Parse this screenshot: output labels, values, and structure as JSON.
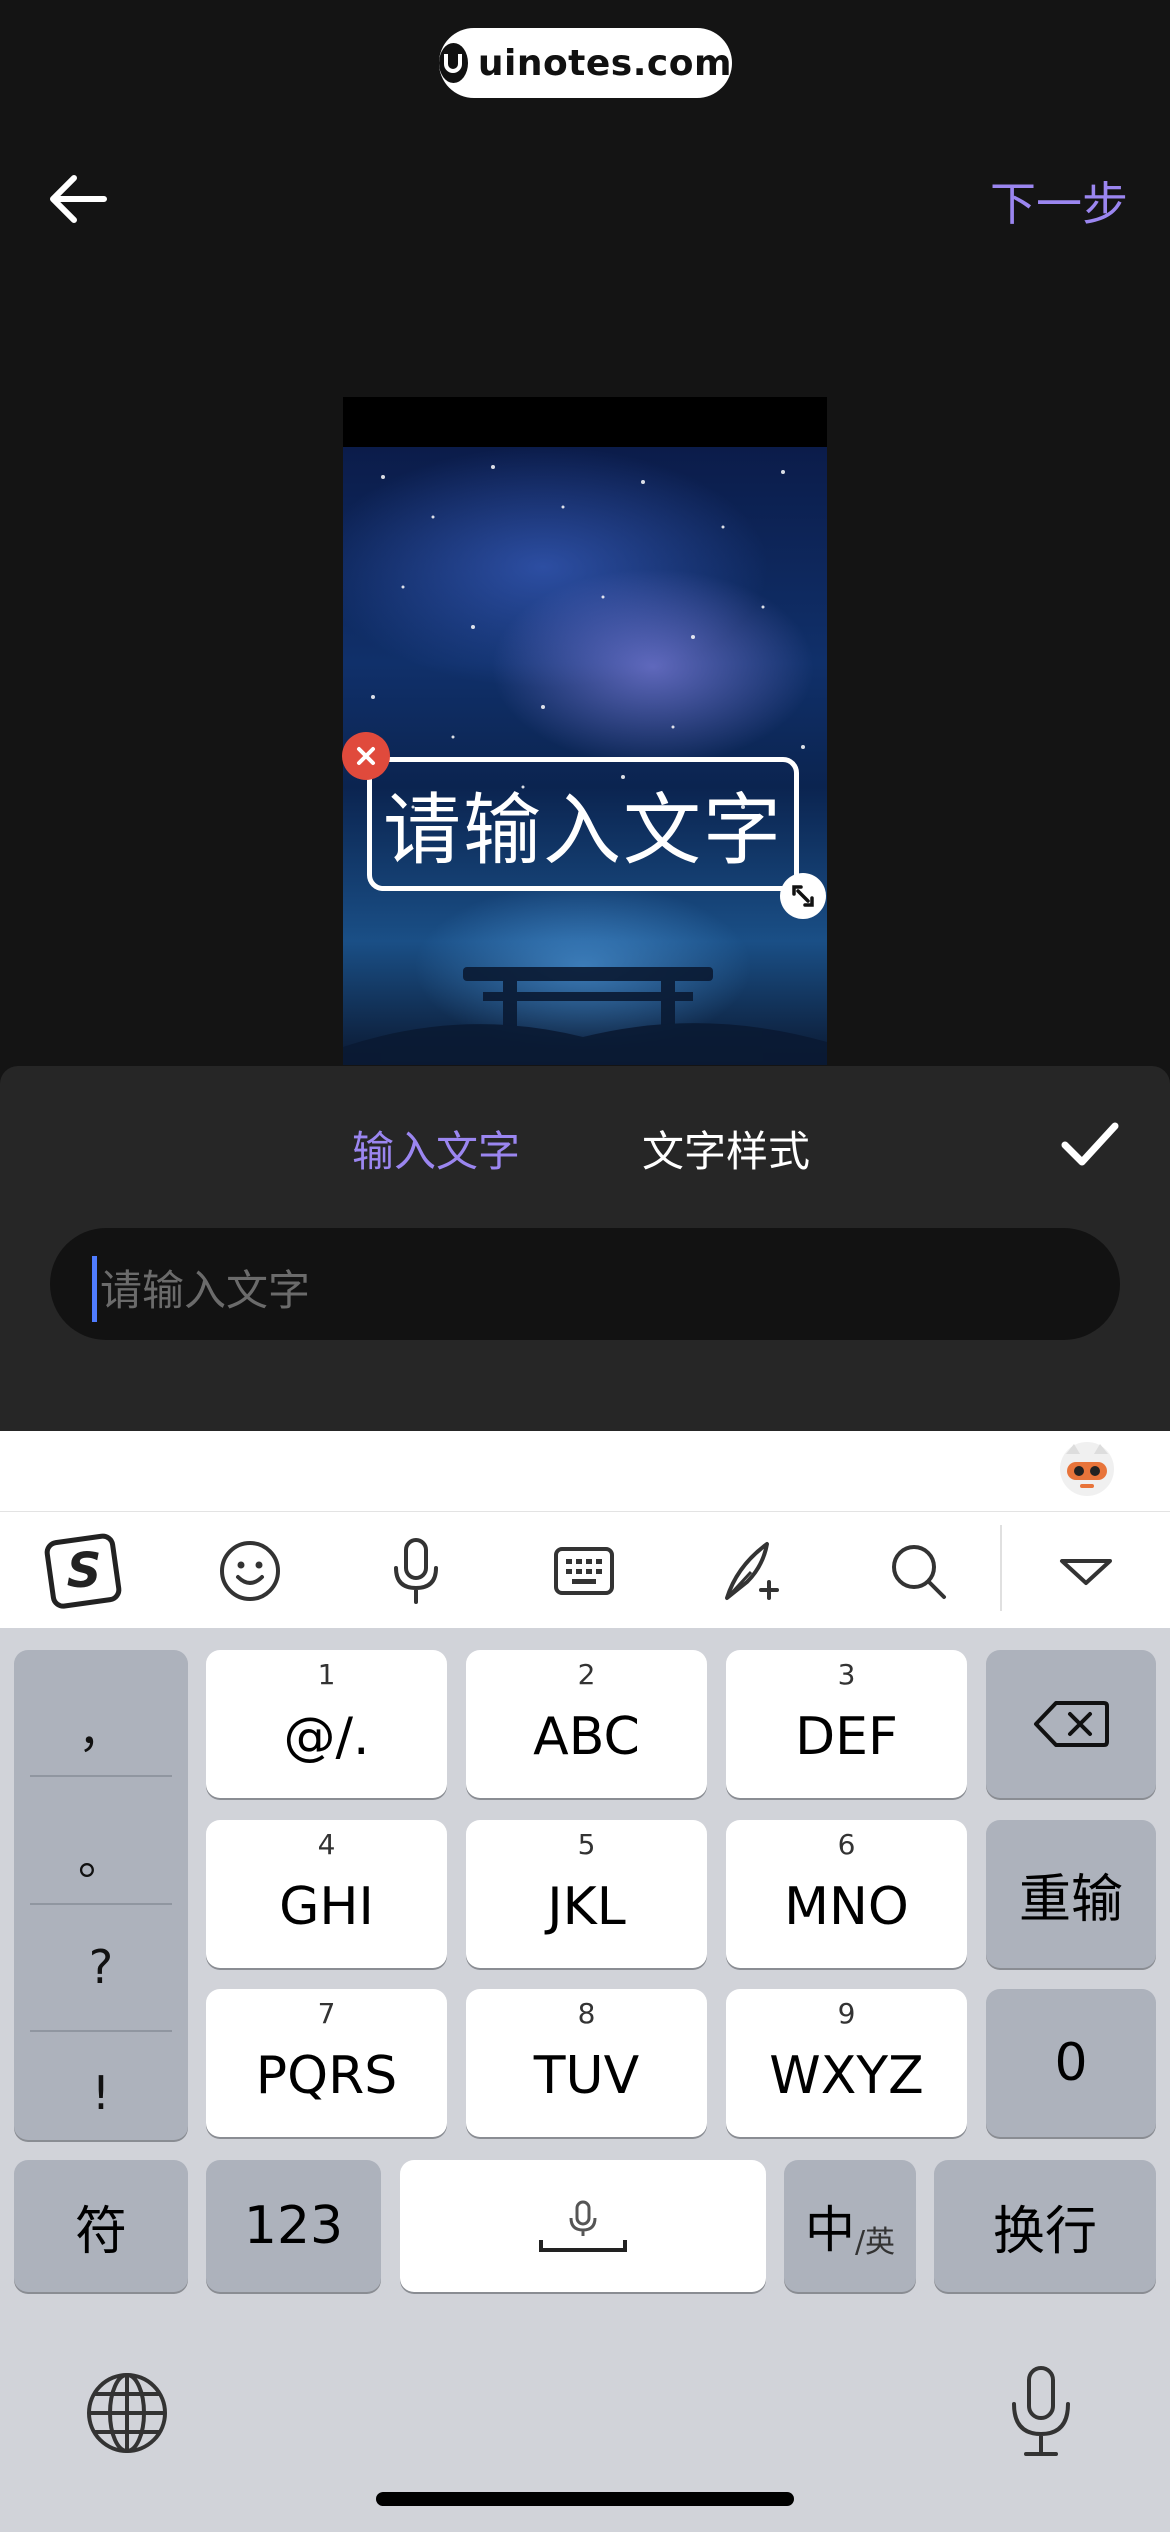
{
  "watermark": {
    "text": "uinotes.com"
  },
  "header": {
    "next_label": "下一步"
  },
  "preview": {
    "overlay_text": "请输入文字"
  },
  "editor": {
    "tabs": [
      {
        "label": "输入文字",
        "active": true
      },
      {
        "label": "文字样式",
        "active": false
      }
    ],
    "input_placeholder": "请输入文字"
  },
  "keyboard": {
    "punctuation": [
      "，",
      "。",
      "?",
      "!"
    ],
    "keys": [
      {
        "num": "1",
        "label": "@/."
      },
      {
        "num": "2",
        "label": "ABC"
      },
      {
        "num": "3",
        "label": "DEF"
      },
      {
        "num": "4",
        "label": "GHI"
      },
      {
        "num": "5",
        "label": "JKL"
      },
      {
        "num": "6",
        "label": "MNO"
      },
      {
        "num": "7",
        "label": "PQRS"
      },
      {
        "num": "8",
        "label": "TUV"
      },
      {
        "num": "9",
        "label": "WXYZ"
      }
    ],
    "reinput_label": "重输",
    "zero_label": "0",
    "symbols_label": "符",
    "numbers_label": "123",
    "lang_main": "中",
    "lang_sub": "/英",
    "return_label": "换行"
  },
  "colors": {
    "accent": "#9b86f0",
    "delete": "#e04a3c",
    "caret": "#4f7cff"
  },
  "icons": {
    "toolbar": [
      "sogou-logo-icon",
      "emoji-icon",
      "microphone-icon",
      "keyboard-icon",
      "quill-icon",
      "search-icon",
      "collapse-icon"
    ]
  }
}
